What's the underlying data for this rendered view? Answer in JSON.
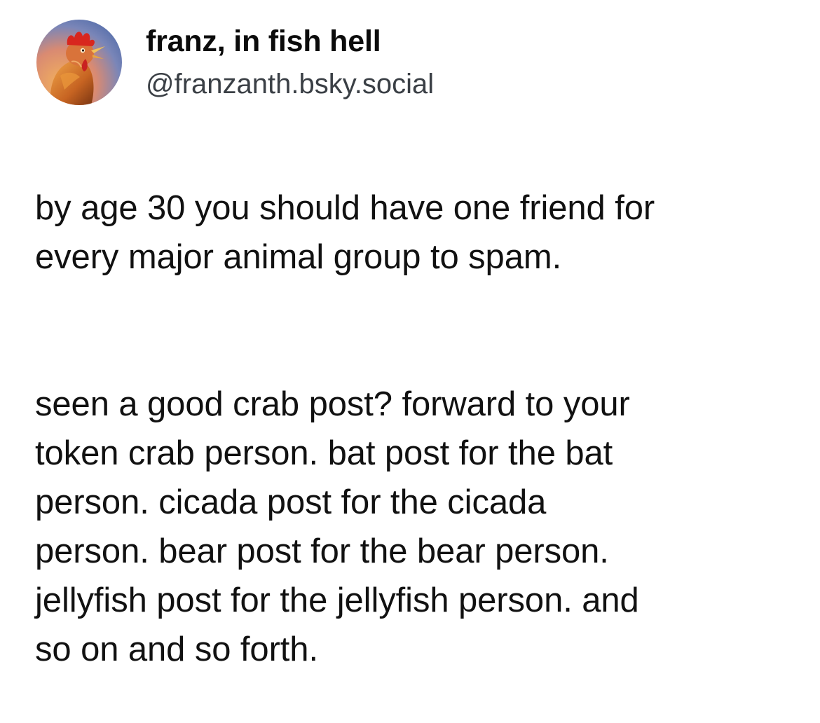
{
  "post": {
    "author": {
      "display_name": "franz, in fish hell",
      "handle": "@franzanth.bsky.social",
      "avatar_icon": "rooster-avatar-icon"
    },
    "paragraphs": [
      "by age 30 you should have one friend for\nevery major animal group to spam.",
      "seen a good crab post? forward to your\ntoken crab person. bat post for the bat\nperson. cicada post for the cicada\nperson. bear post for the bear person.\njellyfish post for the jellyfish person. and\nso on and so forth."
    ]
  },
  "colors": {
    "background": "#ffffff",
    "text": "#111111",
    "handle": "#3a3f45"
  }
}
